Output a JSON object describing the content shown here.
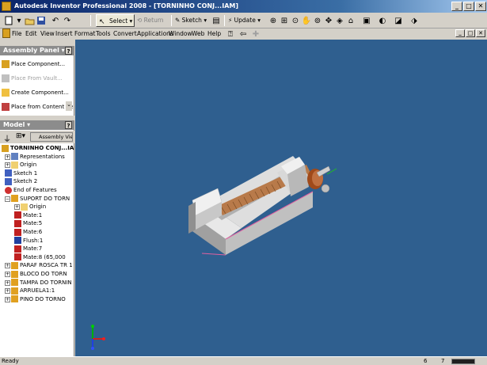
{
  "window": {
    "title": "Autodesk Inventor Professional 2008 - [TORNINHO CONJ...IAM]",
    "buttons": {
      "minimize": "_",
      "maximize": "□",
      "close": "✕"
    },
    "doc_buttons": {
      "minimize": "_",
      "restore": "□",
      "close": "✕"
    }
  },
  "toolbar": {
    "select_label": "Select",
    "return_label": "Return",
    "sketch_label": "Sketch",
    "update_label": "Update"
  },
  "menu": [
    "File",
    "Edit",
    "View",
    "Insert",
    "Format",
    "Tools",
    "Convert",
    "Applications",
    "Window",
    "Web",
    "Help"
  ],
  "assembly_panel": {
    "header": "Assembly Panel ▾",
    "help": "?",
    "items": [
      {
        "label": "Place Component...",
        "enabled": true
      },
      {
        "label": "Place From Vault...",
        "enabled": false
      },
      {
        "label": "Create Component...",
        "enabled": true
      },
      {
        "label": "Place from Content Cen",
        "enabled": true
      }
    ]
  },
  "model_panel": {
    "header": "Model ▾",
    "help": "?",
    "toolbar_label": "Assembly View",
    "tree": [
      {
        "label": "TORNINHO CONJ...IAM",
        "indent": 0,
        "icon": "assembly-icon",
        "bold": true
      },
      {
        "label": "Representations",
        "indent": 1,
        "icon": "representations-icon",
        "expander": "+"
      },
      {
        "label": "Origin",
        "indent": 1,
        "icon": "folder-icon",
        "expander": "+"
      },
      {
        "label": "Sketch 1",
        "indent": 1,
        "icon": "sketch-icon"
      },
      {
        "label": "Sketch 2",
        "indent": 1,
        "icon": "sketch-icon"
      },
      {
        "label": "End of Features",
        "indent": 1,
        "icon": "end-of-features-icon"
      },
      {
        "label": "SUPORT DO TORN",
        "indent": 1,
        "icon": "part-icon",
        "expander": "−"
      },
      {
        "label": "Origin",
        "indent": 2,
        "icon": "folder-icon",
        "expander": "+"
      },
      {
        "label": "Mate:1",
        "indent": 2,
        "icon": "mate-icon"
      },
      {
        "label": "Mate:5",
        "indent": 2,
        "icon": "mate-icon"
      },
      {
        "label": "Mate:6",
        "indent": 2,
        "icon": "mate-icon"
      },
      {
        "label": "Flush:1",
        "indent": 2,
        "icon": "flush-icon"
      },
      {
        "label": "Mate:7",
        "indent": 2,
        "icon": "mate-icon"
      },
      {
        "label": "Mate:8 (65,000",
        "indent": 2,
        "icon": "mate-icon"
      },
      {
        "label": "PARAF ROSCA TR 1",
        "indent": 1,
        "icon": "part-icon",
        "expander": "+"
      },
      {
        "label": "BLOCO DO TORN",
        "indent": 1,
        "icon": "part-icon",
        "expander": "+"
      },
      {
        "label": "TAMPA DO TORNIN",
        "indent": 1,
        "icon": "part-icon",
        "expander": "+"
      },
      {
        "label": "ARRUELA1:1",
        "indent": 1,
        "icon": "part-icon",
        "expander": "+"
      },
      {
        "label": "PINO DO TORNO",
        "indent": 1,
        "icon": "part-icon",
        "expander": "+"
      }
    ]
  },
  "status": {
    "text": "Ready",
    "num1": "6",
    "num2": "7"
  },
  "colors": {
    "viewport_bg": "#2f5f8f",
    "title_bar": "#0a246a",
    "panel_header": "#8c8c8c"
  }
}
